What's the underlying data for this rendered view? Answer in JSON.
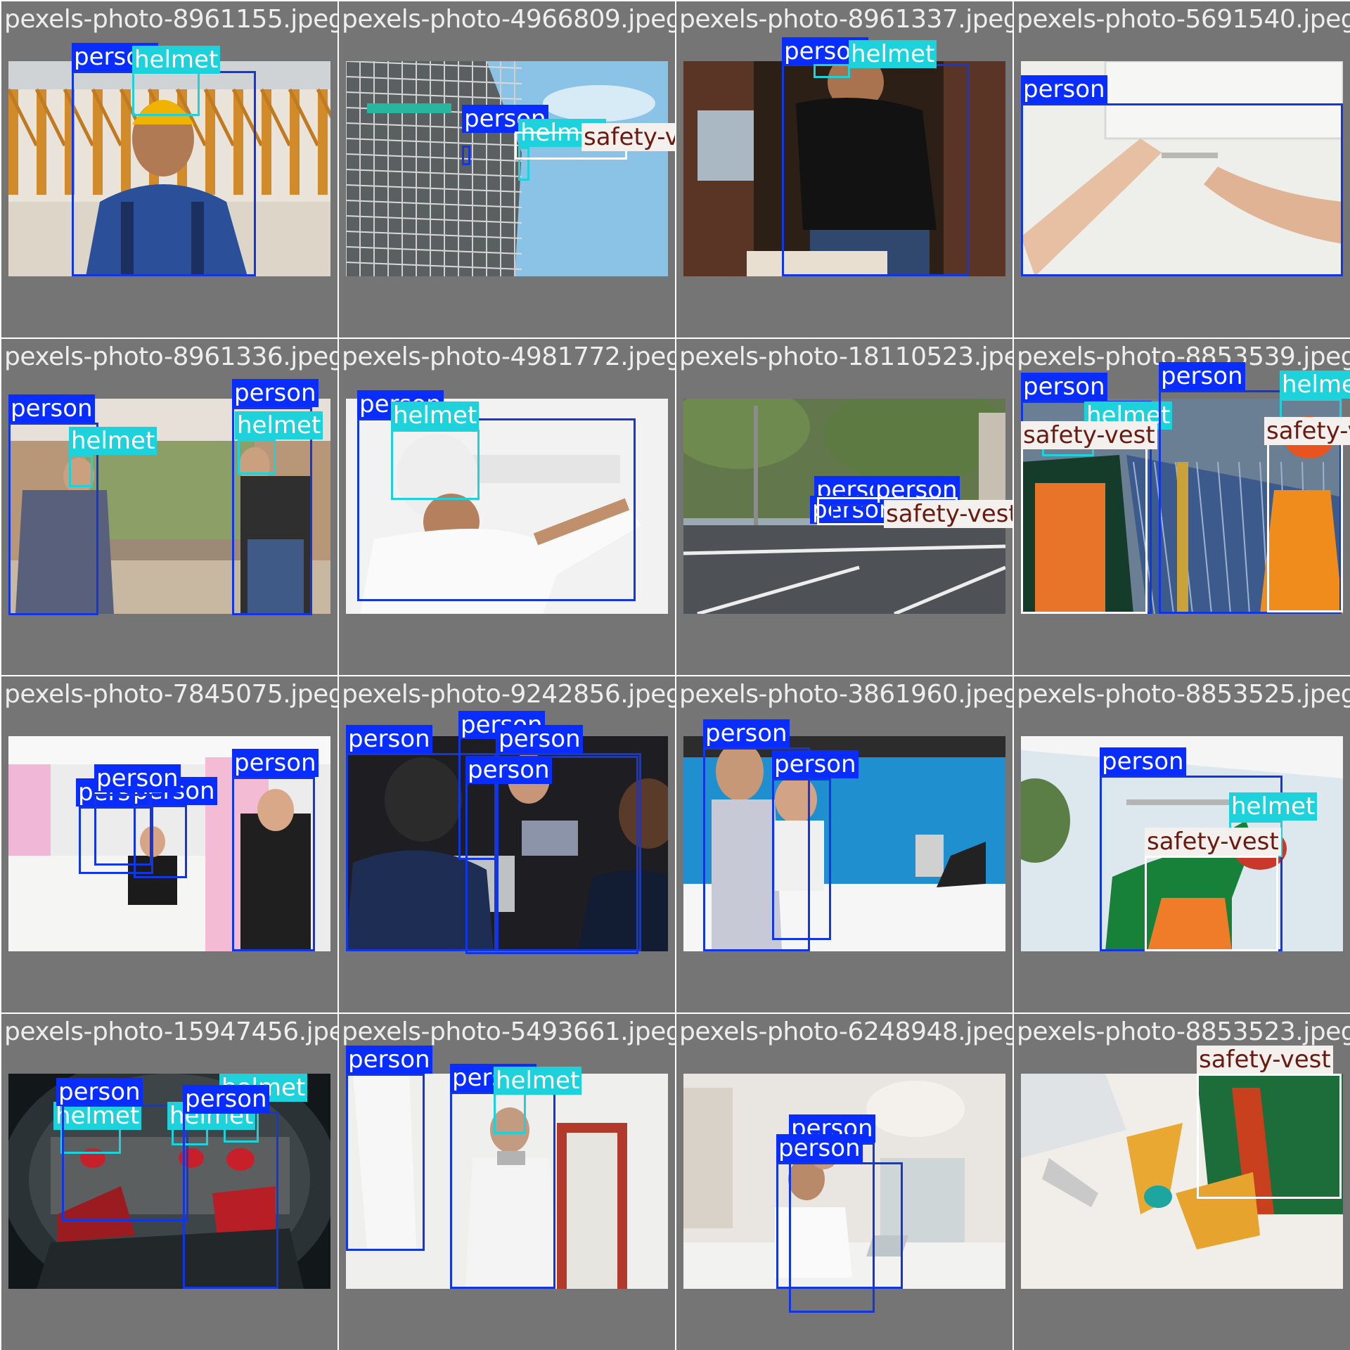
{
  "grid": {
    "background": "#ffffff",
    "cell_background": "#757575",
    "class_colors": {
      "person": "#1236e0",
      "helmet": "#1ed2dc",
      "safety-vest": "#ffffff"
    }
  },
  "labels": {
    "person": "person",
    "helmet": "helmet",
    "safety-vest": "safety-vest"
  },
  "cells": [
    {
      "filename": "pexels-photo-8961155.jpeg",
      "theme": "construction-worker-yellow-helmet",
      "detections": [
        "person",
        "helmet"
      ]
    },
    {
      "filename": "pexels-photo-4966809.jpeg",
      "theme": "scaffolding-building-sky",
      "detections": [
        "person",
        "helmet",
        "safety-vest"
      ]
    },
    {
      "filename": "pexels-photo-8961337.jpeg",
      "theme": "man-drilling-wood",
      "detections": [
        "person",
        "helmet"
      ]
    },
    {
      "filename": "pexels-photo-5691540.jpeg",
      "theme": "hands-measuring-wall",
      "detections": [
        "person"
      ]
    },
    {
      "filename": "pexels-photo-8961336.jpeg",
      "theme": "workshop-two-workers",
      "detections": [
        "person",
        "helmet",
        "person",
        "helmet"
      ]
    },
    {
      "filename": "pexels-photo-4981772.jpeg",
      "theme": "worker-white-helmet-wall",
      "detections": [
        "person",
        "helmet"
      ]
    },
    {
      "filename": "pexels-photo-18110523.jpeg",
      "theme": "street-intersection-trees",
      "detections": [
        "person",
        "person",
        "person",
        "safety-vest"
      ]
    },
    {
      "filename": "pexels-photo-8853539.jpeg",
      "theme": "solar-panel-workers-vests",
      "detections": [
        "person",
        "helmet",
        "safety-vest",
        "person",
        "helmet",
        "safety-vest"
      ]
    },
    {
      "filename": "pexels-photo-7845075.jpeg",
      "theme": "office-businessmen",
      "detections": [
        "person",
        "person",
        "person",
        "person"
      ]
    },
    {
      "filename": "pexels-photo-9242856.jpeg",
      "theme": "students-robotics",
      "detections": [
        "person",
        "person",
        "person",
        "person"
      ]
    },
    {
      "filename": "pexels-photo-3861960.jpeg",
      "theme": "blue-lab-women-laptop",
      "detections": [
        "person",
        "person"
      ]
    },
    {
      "filename": "pexels-photo-8853525.jpeg",
      "theme": "worker-installing-ceiling",
      "detections": [
        "person",
        "helmet",
        "safety-vest"
      ]
    },
    {
      "filename": "pexels-photo-15947456.jpeg",
      "theme": "red-helmet-workers-tunnel",
      "detections": [
        "helmet",
        "person",
        "helmet",
        "helmet",
        "person"
      ]
    },
    {
      "filename": "pexels-photo-5493661.jpeg",
      "theme": "painters-renovation",
      "detections": [
        "person",
        "person",
        "helmet"
      ]
    },
    {
      "filename": "pexels-photo-6248948.jpeg",
      "theme": "office-wheelchair-laptop",
      "detections": [
        "person",
        "person"
      ]
    },
    {
      "filename": "pexels-photo-8853523.jpeg",
      "theme": "gloved-hands-tool",
      "detections": [
        "safety-vest"
      ]
    }
  ]
}
